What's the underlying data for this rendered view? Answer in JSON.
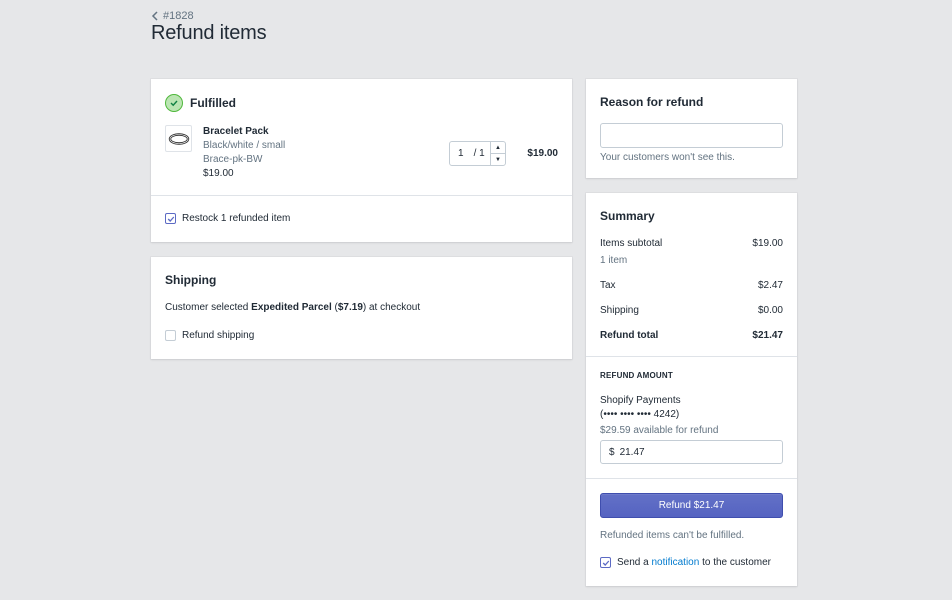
{
  "header": {
    "back_label": "#1828",
    "title": "Refund items"
  },
  "fulfilled": {
    "heading": "Fulfilled",
    "item": {
      "name": "Bracelet Pack",
      "variant": "Black/white / small",
      "sku": "Brace-pk-BW",
      "unit_price": "$19.00",
      "qty_value": "1",
      "qty_max": "/ 1",
      "line_total": "$19.00"
    },
    "restock_label": "Restock 1 refunded item",
    "restock_checked": true
  },
  "shipping": {
    "heading": "Shipping",
    "text_prefix": "Customer selected ",
    "method": "Expedited Parcel",
    "price_open": " (",
    "price": "$7.19",
    "text_suffix": ") at checkout",
    "refund_label": "Refund shipping",
    "refund_checked": false
  },
  "reason": {
    "heading": "Reason for refund",
    "input_value": "",
    "help": "Your customers won't see this."
  },
  "summary": {
    "heading": "Summary",
    "items_subtotal_label": "Items subtotal",
    "items_subtotal_value": "$19.00",
    "items_count": "1 item",
    "tax_label": "Tax",
    "tax_value": "$2.47",
    "shipping_label": "Shipping",
    "shipping_value": "$0.00",
    "total_label": "Refund total",
    "total_value": "$21.47",
    "refund_amount_heading": "REFUND AMOUNT",
    "gateway": "Shopify Payments",
    "card_mask": "(•••• •••• •••• 4242)",
    "available": "$29.59 available for refund",
    "currency_symbol": "$",
    "amount_value": "21.47",
    "refund_button": "Refund $21.47",
    "note": "Refunded items can't be fulfilled.",
    "notify_prefix": "Send a ",
    "notify_link": "notification",
    "notify_suffix": " to the customer",
    "notify_checked": true
  },
  "colors": {
    "primary": "#5c6ac4",
    "success": "#50b83c",
    "background": "#e6e7e9"
  }
}
